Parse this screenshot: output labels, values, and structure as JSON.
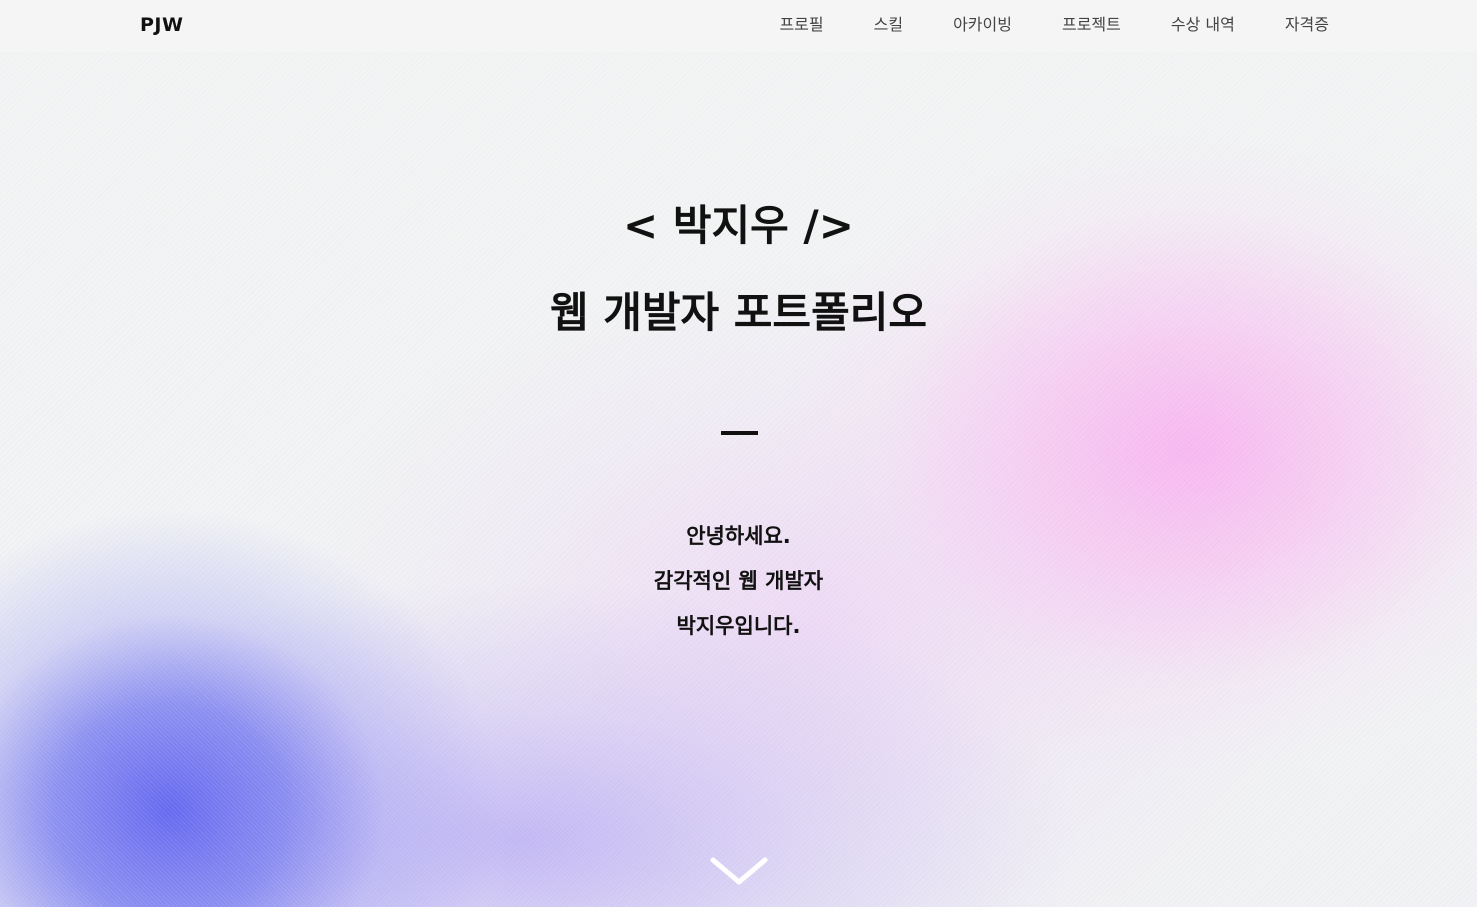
{
  "header": {
    "logo": "PJW",
    "nav": [
      {
        "label": "프로필"
      },
      {
        "label": "스킬"
      },
      {
        "label": "아카이빙"
      },
      {
        "label": "프로젝트"
      },
      {
        "label": "수상 내역"
      },
      {
        "label": "자격증"
      }
    ]
  },
  "hero": {
    "name": "< 박지우 />",
    "subtitle": "웹 개발자 포트폴리오",
    "intro_lines": [
      "안녕하세요.",
      "감각적인 웹 개발자",
      "박지우입니다."
    ]
  },
  "icons": {
    "scroll": "chevron-down-icon"
  },
  "colors": {
    "text": "#111111",
    "nav_text": "#444444",
    "header_bg": "#f5f5f5",
    "accent_blue": "#5f64f0",
    "accent_pink": "#f8b4f0"
  }
}
